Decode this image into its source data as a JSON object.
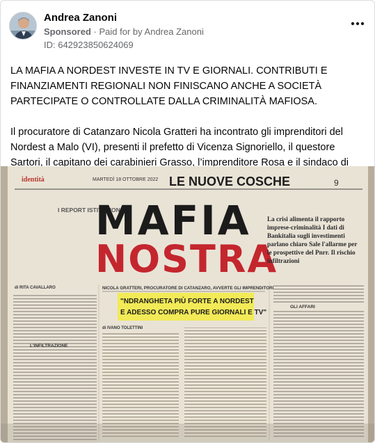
{
  "post": {
    "author": "Andrea Zanoni",
    "sponsored_label": "Sponsored",
    "paid_prefix": "Paid for by",
    "paid_by": "Andrea Zanoni",
    "ad_id": "ID: 642923850624069",
    "headline": "LA MAFIA A NORDEST INVESTE IN TV E GIORNALI. CONTRIBUTI E FINANZIAMENTI REGIONALI NON FINISCANO ANCHE A SOCIETÀ PARTECIPATE O CONTROLLATE DALLA CRIMINALITÀ MAFIOSA.",
    "body": "Il procuratore di Catanzaro Nicola Gratteri ha incontrato gli imprenditori del Nordest a Malo (VI), presenti il prefetto di Vicenza Signoriello, il questore Sartori, il capitano dei carabinieri Grasso, l’imprenditore Rosa e il sindaco di Schio Orsi...."
  },
  "newspaper": {
    "masthead": "identità",
    "date": "MARTEDÌ 18 OTTOBRE 2022",
    "section": "LE NUOVE COSCHE",
    "page": "9",
    "kicker": "I REPORT ISTITUZIONALI",
    "title_line1": "MAFIA",
    "title_line2": "NOSTRA",
    "deck": "La crisi alimenta il rapporto imprese-criminalità I dati di Bankitalia sugli investimenti parlano chiaro Sale l'allarme per le prospettive del Pnrr. Il rischio infiltrazioni",
    "byline_left": "di RITA CAVALLARO",
    "subhead": "NICOLA GRATTERI, PROCURATORE DI CATANZARO, AVVERTE GLI IMPRENDITORI",
    "quote_line1": "\"NDRANGHETA PIÙ FORTE A NORDEST",
    "quote_line2": "E ADESSO COMPRA PURE GIORNALI E TV\"",
    "byline_center": "di IVANO TOLETTINI",
    "section_head_left": "L'INFILTRAZIONE",
    "section_head_right": "GLI AFFARI"
  }
}
